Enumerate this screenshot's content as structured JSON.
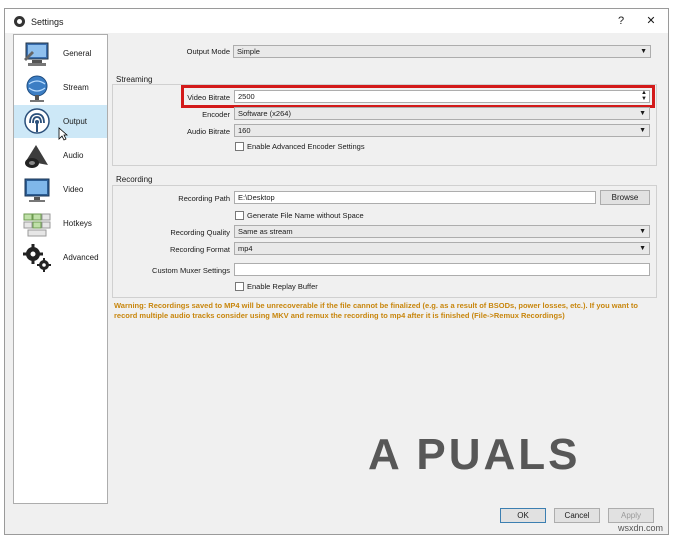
{
  "window": {
    "title": "Settings",
    "help_label": "?",
    "close_label": "✕"
  },
  "sidebar": {
    "items": [
      {
        "label": "General",
        "icon": "general-icon",
        "selected": false
      },
      {
        "label": "Stream",
        "icon": "stream-icon",
        "selected": false
      },
      {
        "label": "Output",
        "icon": "output-icon",
        "selected": true
      },
      {
        "label": "Audio",
        "icon": "audio-icon",
        "selected": false
      },
      {
        "label": "Video",
        "icon": "video-icon",
        "selected": false
      },
      {
        "label": "Hotkeys",
        "icon": "hotkeys-icon",
        "selected": false
      },
      {
        "label": "Advanced",
        "icon": "advanced-icon",
        "selected": false
      }
    ]
  },
  "output_mode": {
    "label": "Output Mode",
    "value": "Simple"
  },
  "streaming": {
    "title": "Streaming",
    "video_bitrate": {
      "label": "Video Bitrate",
      "value": "2500"
    },
    "encoder": {
      "label": "Encoder",
      "value": "Software (x264)"
    },
    "audio_bitrate": {
      "label": "Audio Bitrate",
      "value": "160"
    },
    "advanced_encoder": {
      "label": "Enable Advanced Encoder Settings",
      "checked": false
    }
  },
  "recording": {
    "title": "Recording",
    "path": {
      "label": "Recording Path",
      "value": "E:\\Desktop"
    },
    "browse_label": "Browse",
    "no_space": {
      "label": "Generate File Name without Space",
      "checked": false
    },
    "quality": {
      "label": "Recording Quality",
      "value": "Same as stream"
    },
    "format": {
      "label": "Recording Format",
      "value": "mp4"
    },
    "muxer": {
      "label": "Custom Muxer Settings",
      "value": ""
    },
    "replay_buffer": {
      "label": "Enable Replay Buffer",
      "checked": false
    }
  },
  "warning": "Warning: Recordings saved to MP4 will be unrecoverable if the file cannot be finalized (e.g. as a result of BSODs, power losses, etc.). If you want to record multiple audio tracks consider using MKV and remux the recording to mp4 after it is finished (File->Remux Recordings)",
  "footer": {
    "ok_label": "OK",
    "cancel_label": "Cancel",
    "apply_label": "Apply"
  },
  "watermark": {
    "text": "A PUALS",
    "site": "wsxdn.com"
  },
  "colors": {
    "warning": "#c8860d",
    "highlight": "#d31a1a",
    "selection": "#cde8f7"
  }
}
